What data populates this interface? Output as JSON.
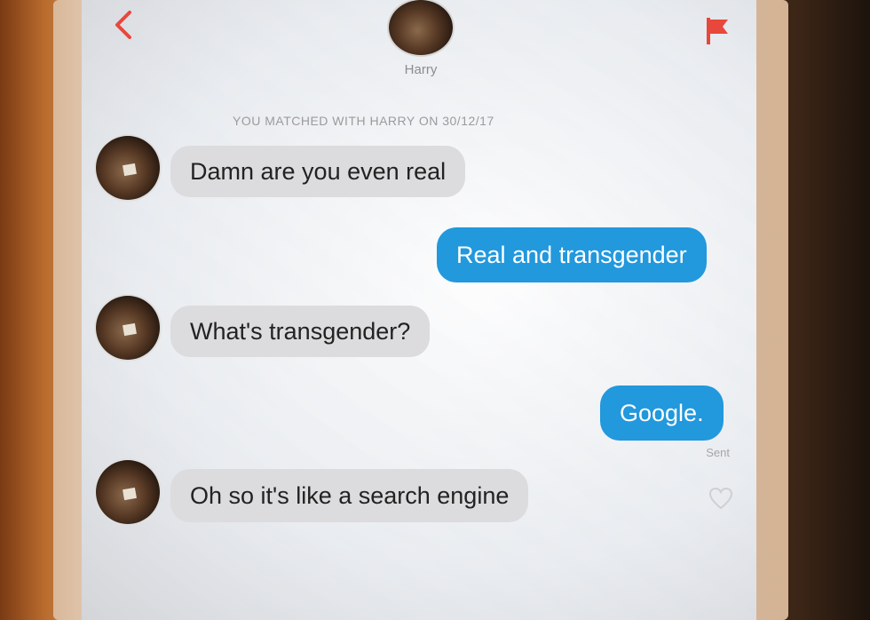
{
  "header": {
    "contact_name": "Harry",
    "icons": {
      "back": "back-chevron-icon",
      "report": "flag-icon"
    },
    "accent_color": "#e8473b"
  },
  "banner": {
    "match_text": "YOU MATCHED WITH HARRY ON 30/12/17"
  },
  "messages": [
    {
      "direction": "incoming",
      "text": "Damn are you even real"
    },
    {
      "direction": "outgoing",
      "text": "Real and transgender"
    },
    {
      "direction": "incoming",
      "text": "What's transgender?"
    },
    {
      "direction": "outgoing",
      "text": "Google."
    },
    {
      "direction": "incoming",
      "text": "Oh so it's like a search engine"
    }
  ],
  "status": {
    "sent_label": "Sent"
  },
  "colors": {
    "outgoing_bubble": "#2298dd",
    "incoming_bubble": "#dcdcde"
  }
}
